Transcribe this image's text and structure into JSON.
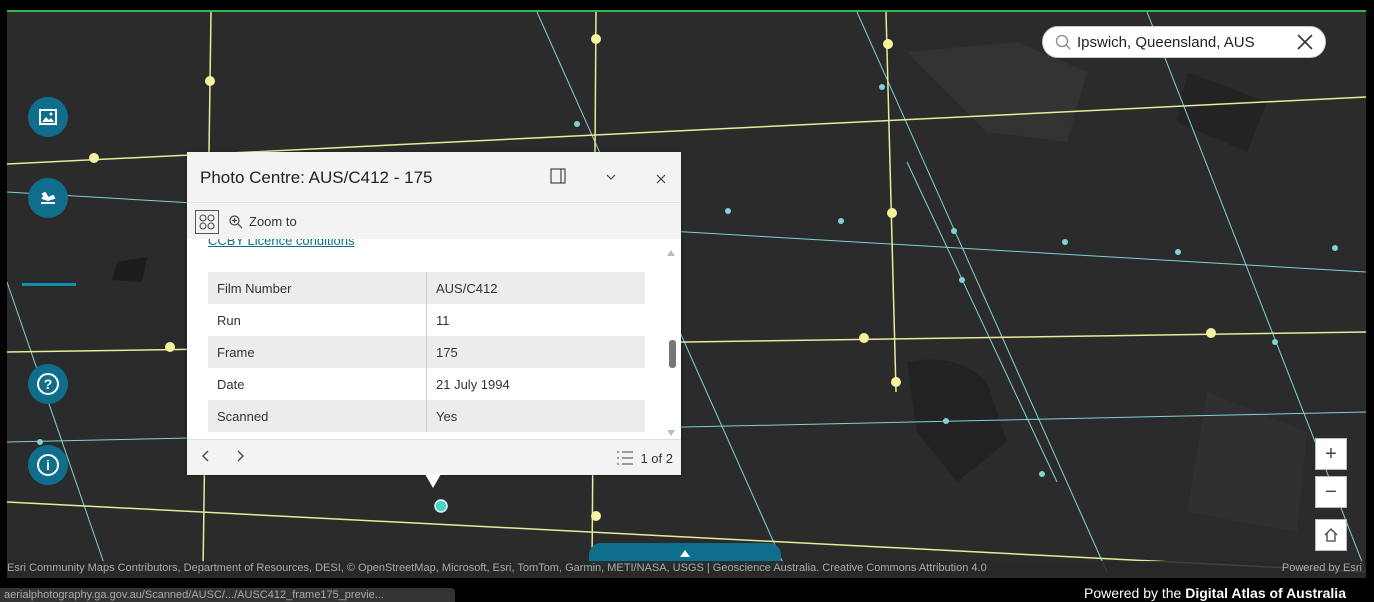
{
  "search": {
    "value": "Ipswich, Queensland, AUS"
  },
  "sidebar": {
    "items": [
      {
        "name": "imagery",
        "icon": "image-icon"
      },
      {
        "name": "flight",
        "icon": "airplane-icon"
      },
      {
        "name": "help",
        "icon": "question-icon",
        "label": "?"
      },
      {
        "name": "info",
        "icon": "info-icon",
        "label": "i"
      }
    ]
  },
  "popup": {
    "title": "Photo Centre: AUS/C412 - 175",
    "zoom_to": "Zoom to",
    "link_text": "CCBY Licence conditions",
    "rows": [
      {
        "key": "Film Number",
        "value": "AUS/C412"
      },
      {
        "key": "Run",
        "value": "11"
      },
      {
        "key": "Frame",
        "value": "175"
      },
      {
        "key": "Date",
        "value": "21 July 1994"
      },
      {
        "key": "Scanned",
        "value": "Yes"
      }
    ],
    "count": "1 of 2"
  },
  "zoom": {
    "in": "+",
    "out": "−"
  },
  "attribution": {
    "left": "Esri Community Maps Contributors, Department of Resources, DESI, © OpenStreetMap, Microsoft, Esri, TomTom, Garmin, METI/NASA, USGS | Geoscience Australia. Creative Commons Attribution 4.0",
    "right": "Powered by Esri"
  },
  "status_url": "aerialphotography.ga.gov.au/Scanned/AUSC/.../AUSC412_frame175_previe...",
  "footer": {
    "prefix": "Powered by the ",
    "brand": "Digital Atlas of Australia"
  },
  "colors": {
    "accent": "#0f6e8c",
    "yellow_line": "#e8eb9a",
    "blue_line": "#7fd3d8",
    "map_bg": "#2b2b2b"
  }
}
